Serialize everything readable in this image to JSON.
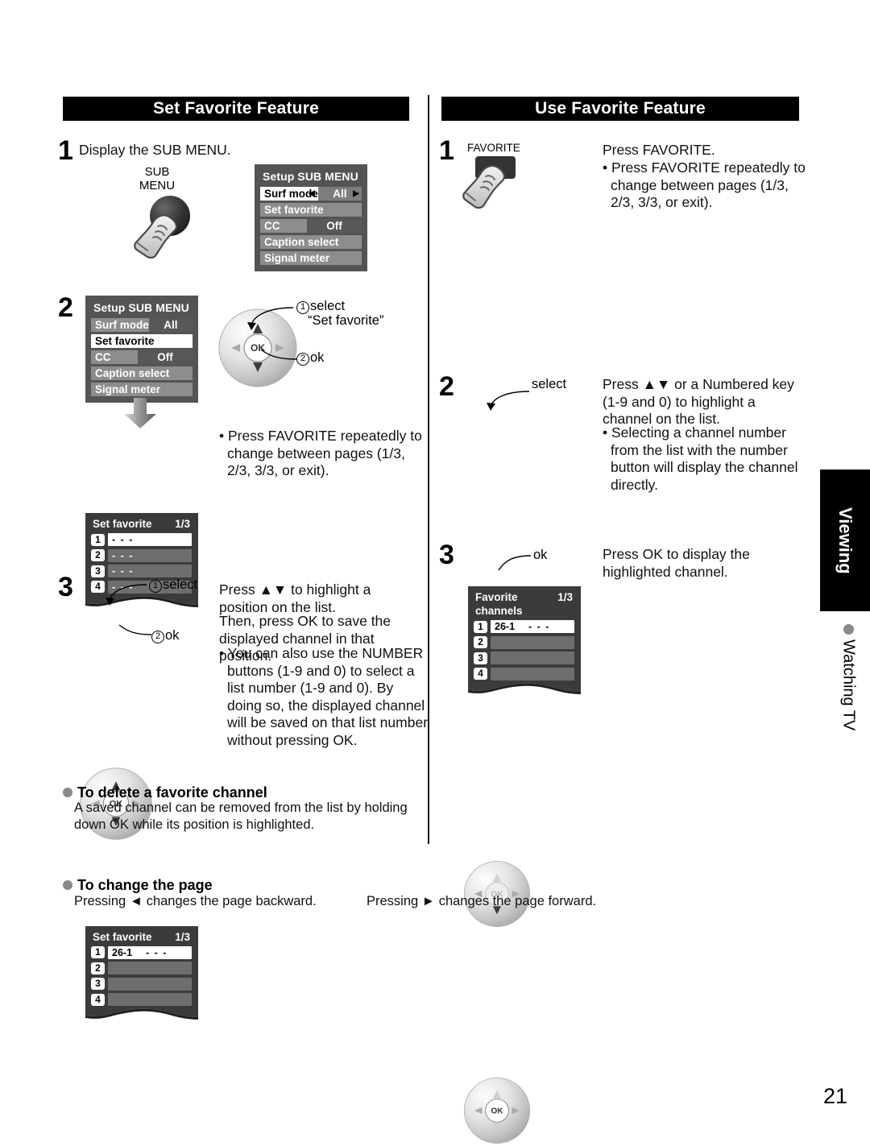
{
  "page": {
    "number": "21",
    "side_tab": "Viewing",
    "side_label": "Watching TV"
  },
  "left_column": {
    "banner": "Set Favorite Feature",
    "step1": {
      "number": "1",
      "instruction": "Display the SUB MENU.",
      "button_label_line1": "SUB",
      "button_label_line2": "MENU",
      "menu": {
        "title": "Setup SUB MENU",
        "rows": [
          {
            "label": "Surf mode",
            "value": "All",
            "selected": true,
            "arrows": true
          },
          {
            "label": "Set favorite",
            "value": "",
            "selected": false,
            "arrows": false
          },
          {
            "label": "CC",
            "value": "Off",
            "selected": false,
            "arrows": false
          },
          {
            "label": "Caption select",
            "value": "",
            "selected": false,
            "arrows": false
          },
          {
            "label": "Signal meter",
            "value": "",
            "selected": false,
            "arrows": false
          }
        ]
      }
    },
    "step2": {
      "number": "2",
      "menu": {
        "title": "Setup SUB MENU",
        "rows": [
          {
            "label": "Surf mode",
            "value": "All",
            "selected": false,
            "arrows": false
          },
          {
            "label": "Set favorite",
            "value": "",
            "selected": true,
            "arrows": false
          },
          {
            "label": "CC",
            "value": "Off",
            "selected": false,
            "arrows": false
          },
          {
            "label": "Caption select",
            "value": "",
            "selected": false,
            "arrows": false
          },
          {
            "label": "Signal meter",
            "value": "",
            "selected": false,
            "arrows": false
          }
        ]
      },
      "callout_select_num": "1",
      "callout_select": "select",
      "callout_select_target": "“Set favorite”",
      "callout_ok_num": "2",
      "callout_ok": "ok",
      "list": {
        "title": "Set favorite",
        "page": "1/3",
        "rows": [
          {
            "badge": "1",
            "channel": "",
            "dashes": "- - -",
            "selected": true
          },
          {
            "badge": "2",
            "channel": "",
            "dashes": "- - -",
            "selected": false
          },
          {
            "badge": "3",
            "channel": "",
            "dashes": "- - -",
            "selected": false
          },
          {
            "badge": "4",
            "channel": "",
            "dashes": "- - -",
            "selected": false
          }
        ]
      },
      "note": "• Press FAVORITE repeatedly to change between pages (1/3, 2/3, 3/3, or exit)."
    },
    "step3": {
      "number": "3",
      "callout_select_num": "1",
      "callout_select": "select",
      "callout_ok_num": "2",
      "callout_ok": "ok",
      "list": {
        "title": "Set favorite",
        "page": "1/3",
        "rows": [
          {
            "badge": "1",
            "channel": "26-1",
            "dashes": "- - -",
            "selected": true
          },
          {
            "badge": "2",
            "channel": "",
            "dashes": "",
            "selected": false
          },
          {
            "badge": "3",
            "channel": "",
            "dashes": "",
            "selected": false
          },
          {
            "badge": "4",
            "channel": "",
            "dashes": "",
            "selected": false
          }
        ]
      },
      "text_line1": "Press ▲▼ to highlight a position on the list.",
      "text_line2": "Then, press OK to save the displayed channel in that position.",
      "text_line3": "• You can also use the NUMBER buttons (1-9 and 0) to select a list number (1-9 and 0). By doing so, the displayed channel will be saved on that list number without pressing OK."
    }
  },
  "right_column": {
    "banner": "Use Favorite Feature",
    "step1": {
      "number": "1",
      "button_label": "FAVORITE",
      "text_line1": "Press FAVORITE.",
      "text_line2": "• Press FAVORITE repeatedly to change between pages (1/3, 2/3, 3/3, or exit).",
      "list": {
        "title": "Favorite channels",
        "page": "1/3",
        "rows": [
          {
            "badge": "1",
            "channel": "26-1",
            "dashes": "- - -",
            "selected": true
          },
          {
            "badge": "2",
            "channel": "",
            "dashes": "",
            "selected": false
          },
          {
            "badge": "3",
            "channel": "",
            "dashes": "",
            "selected": false
          },
          {
            "badge": "4",
            "channel": "",
            "dashes": "",
            "selected": false
          }
        ]
      }
    },
    "step2": {
      "number": "2",
      "callout_select": "select",
      "text_line1": "Press ▲▼ or a Numbered key (1-9 and 0) to highlight a channel on the list.",
      "text_line2": "• Selecting a channel number from the list with the number button will display the channel directly."
    },
    "step3": {
      "number": "3",
      "callout_ok": "ok",
      "text_line1": "Press OK to display the highlighted channel."
    }
  },
  "footer": {
    "delete": {
      "heading": "To delete a favorite channel",
      "body": "A saved channel can be removed from the list by holding down OK while its position is highlighted."
    },
    "changepage": {
      "heading": "To change the page",
      "left": "Pressing ◄ changes the page backward.",
      "right": "Pressing ► changes the page forward."
    }
  },
  "colors": {
    "banner_bg": "#000000",
    "osd_bg": "#545454",
    "osd_row": "#8d8d8d",
    "list_bg": "#3b3b3b",
    "slot": "#6e6e6e",
    "bullet": "#8a8a8a"
  }
}
